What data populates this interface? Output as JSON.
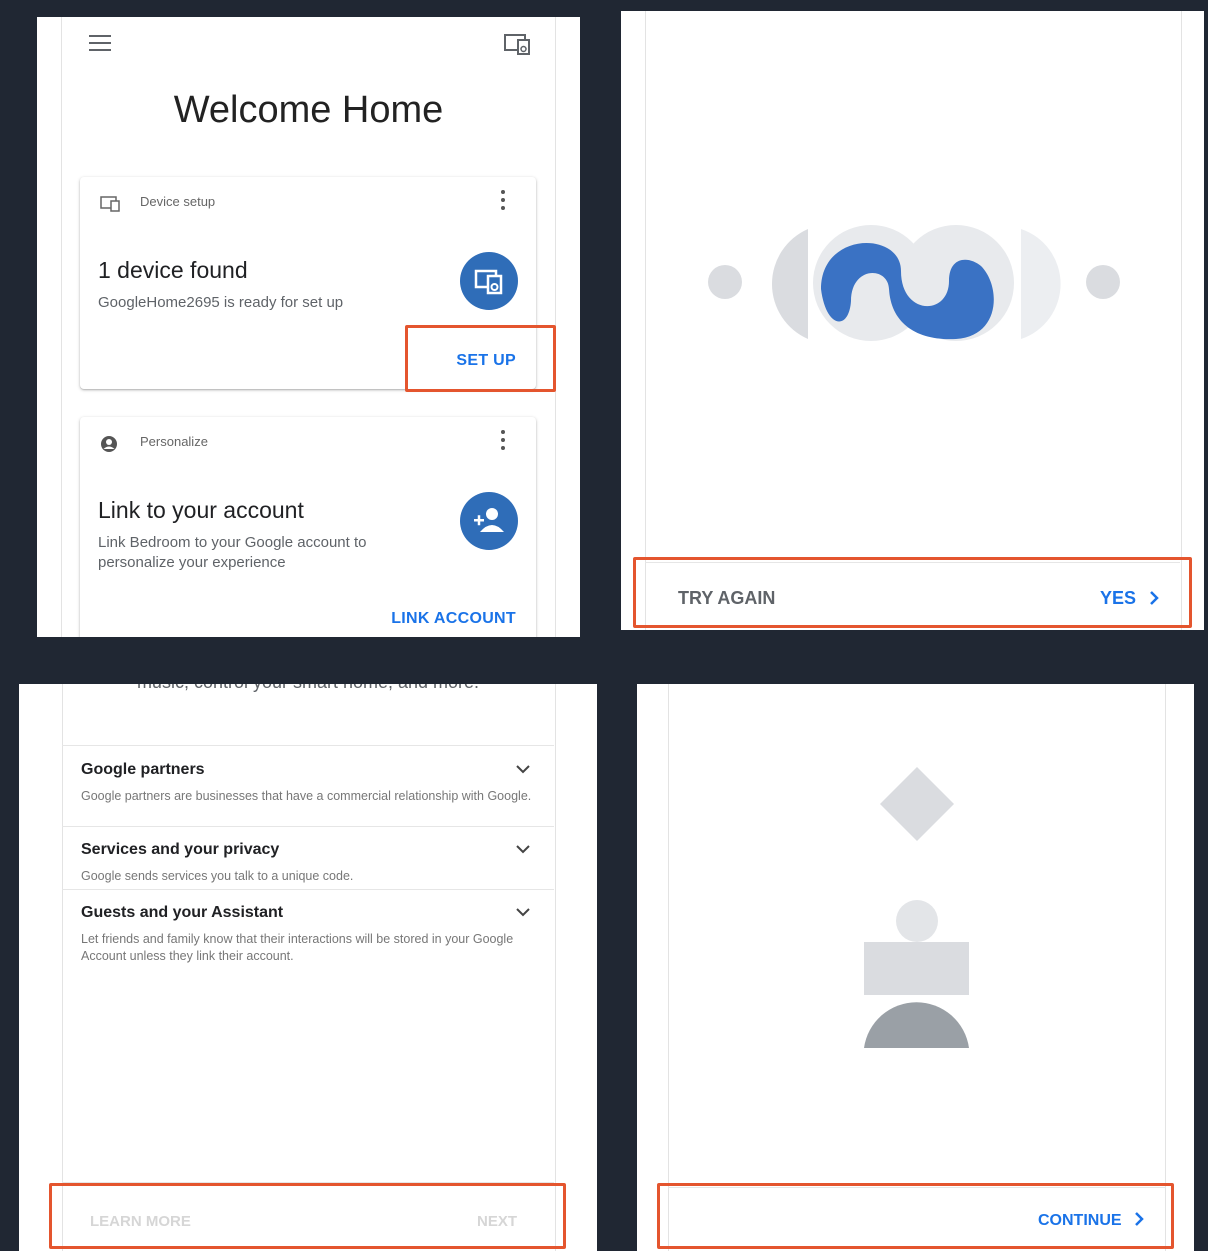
{
  "colors": {
    "accent": "#1a73e8",
    "fab": "#2f6db8",
    "highlight": "#e4552e",
    "background": "#202733"
  },
  "panel_home": {
    "icons": {
      "menu": "menu-icon",
      "cast": "cast-device-icon"
    },
    "title": "Welcome Home",
    "device_card": {
      "header": "Device setup",
      "title": "1 device found",
      "subtitle": "GoogleHome2695 is ready for set up",
      "action": "SET UP"
    },
    "personalize_card": {
      "header": "Personalize",
      "title": "Link to your account",
      "subtitle": "Link Bedroom to your Google account to personalize your experience",
      "action": "LINK ACCOUNT"
    }
  },
  "panel_sound": {
    "try_again": "TRY AGAIN",
    "yes": "YES"
  },
  "panel_privacy": {
    "intro_tail": "music, control your smart home, and more.",
    "sections": [
      {
        "title": "Google partners",
        "body": "Google partners are businesses that have a commercial relationship with Google."
      },
      {
        "title": "Services and your privacy",
        "body": "Google sends services you talk to a unique code."
      },
      {
        "title": "Guests and your Assistant",
        "body": "Let friends and family know that their interactions will be stored in your Google Account unless they link their account."
      }
    ],
    "learn_more": "LEARN MORE",
    "next": "NEXT"
  },
  "panel_voice": {
    "continue": "CONTINUE"
  }
}
